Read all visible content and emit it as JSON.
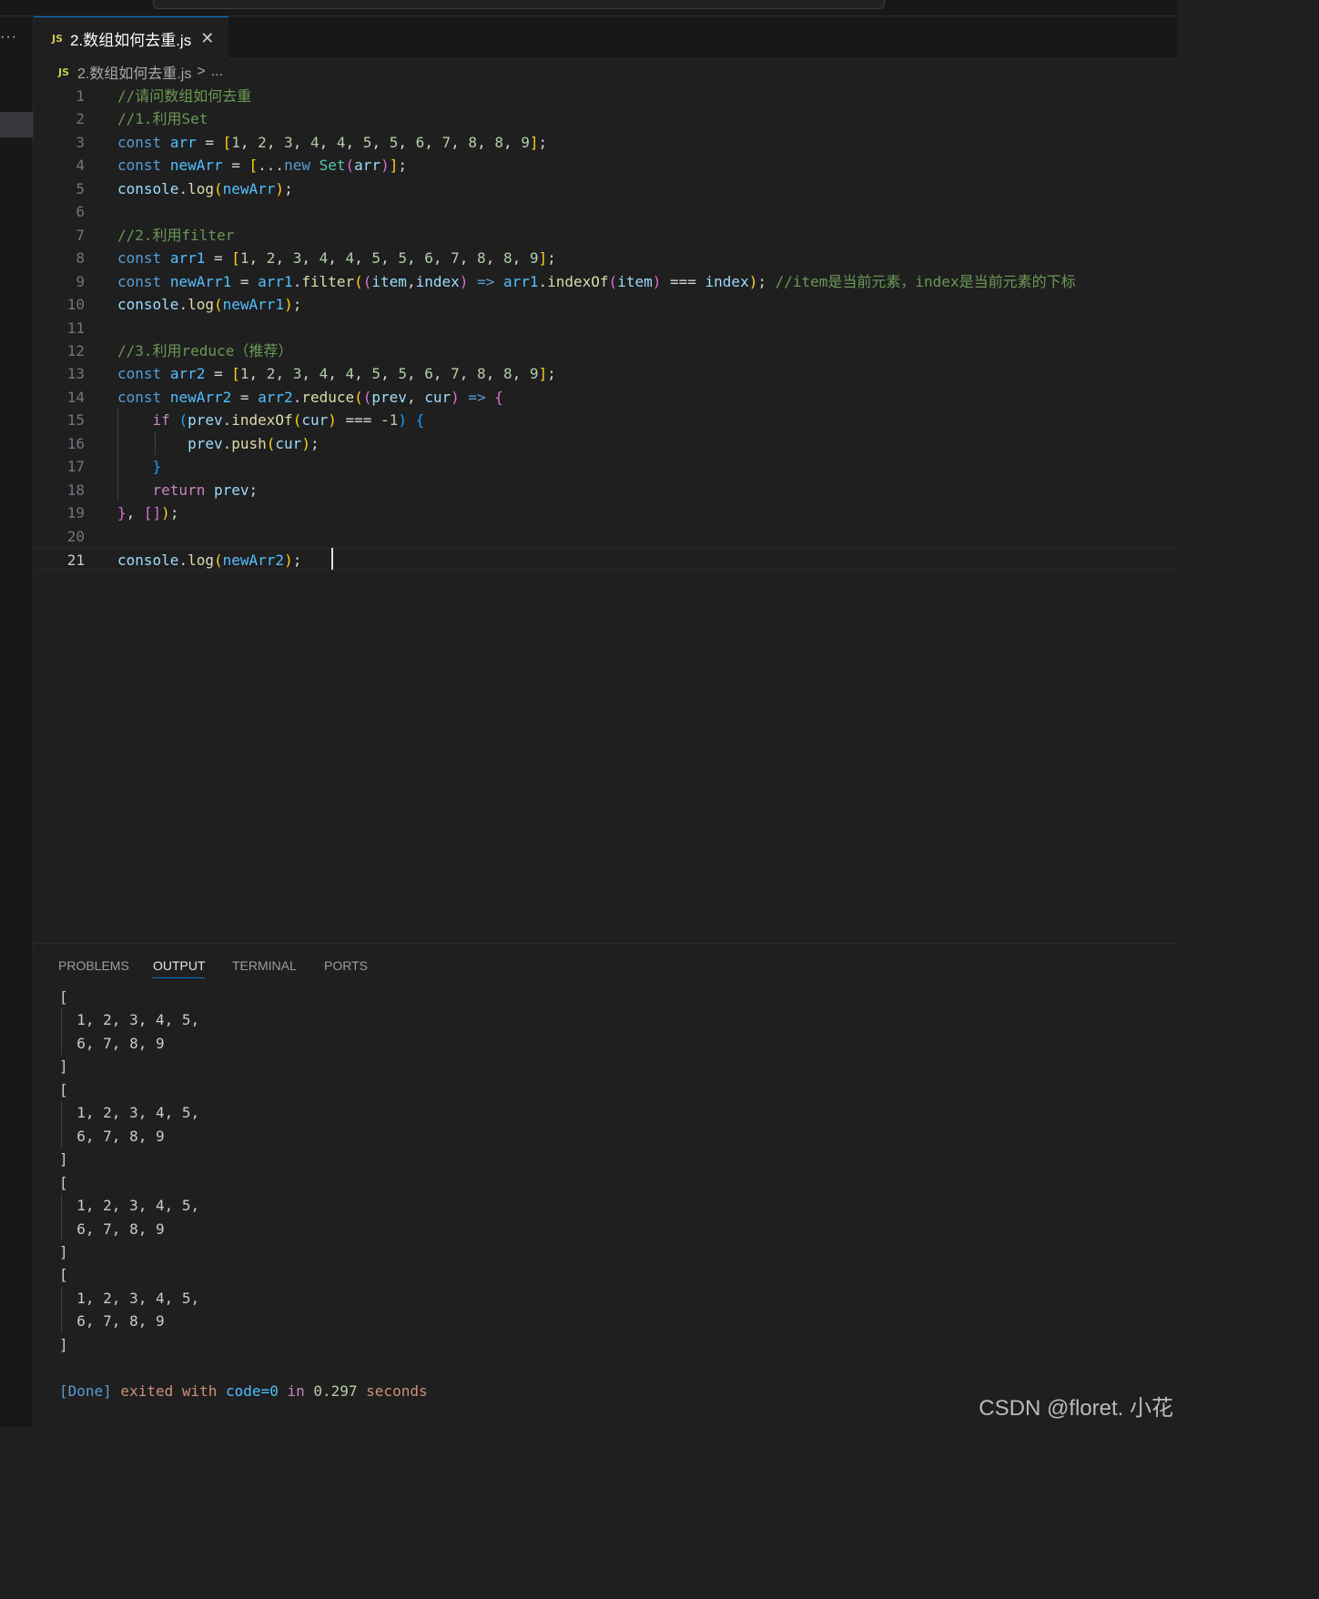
{
  "tab": {
    "badge": "JS",
    "title": "2.数组如何去重.js",
    "close": "✕"
  },
  "sidebar": {
    "overflow": "···"
  },
  "breadcrumb": {
    "badge": "JS",
    "file": "2.数组如何去重.js",
    "sep": ">",
    "rest": "..."
  },
  "editor": {
    "lines": [
      {
        "n": "1",
        "tokens": [
          [
            "c-com",
            "//请问数组如何去重"
          ]
        ]
      },
      {
        "n": "2",
        "tokens": [
          [
            "c-com",
            "//1.利用Set"
          ]
        ]
      },
      {
        "n": "3",
        "tokens": [
          [
            "c-kw",
            "const"
          ],
          [
            "c-op",
            " "
          ],
          [
            "c-cst",
            "arr"
          ],
          [
            "c-op",
            " = "
          ],
          [
            "b1",
            "["
          ],
          [
            "c-num",
            "1"
          ],
          [
            "c-op",
            ", "
          ],
          [
            "c-num",
            "2"
          ],
          [
            "c-op",
            ", "
          ],
          [
            "c-num",
            "3"
          ],
          [
            "c-op",
            ", "
          ],
          [
            "c-num",
            "4"
          ],
          [
            "c-op",
            ", "
          ],
          [
            "c-num",
            "4"
          ],
          [
            "c-op",
            ", "
          ],
          [
            "c-num",
            "5"
          ],
          [
            "c-op",
            ", "
          ],
          [
            "c-num",
            "5"
          ],
          [
            "c-op",
            ", "
          ],
          [
            "c-num",
            "6"
          ],
          [
            "c-op",
            ", "
          ],
          [
            "c-num",
            "7"
          ],
          [
            "c-op",
            ", "
          ],
          [
            "c-num",
            "8"
          ],
          [
            "c-op",
            ", "
          ],
          [
            "c-num",
            "8"
          ],
          [
            "c-op",
            ", "
          ],
          [
            "c-num",
            "9"
          ],
          [
            "b1",
            "]"
          ],
          [
            "c-op",
            ";"
          ]
        ]
      },
      {
        "n": "4",
        "tokens": [
          [
            "c-kw",
            "const"
          ],
          [
            "c-op",
            " "
          ],
          [
            "c-cst",
            "newArr"
          ],
          [
            "c-op",
            " = "
          ],
          [
            "b1",
            "["
          ],
          [
            "c-op",
            "..."
          ],
          [
            "c-kw",
            "new"
          ],
          [
            "c-op",
            " "
          ],
          [
            "c-cls",
            "Set"
          ],
          [
            "b2",
            "("
          ],
          [
            "c-var",
            "arr"
          ],
          [
            "b2",
            ")"
          ],
          [
            "b1",
            "]"
          ],
          [
            "c-op",
            ";"
          ]
        ]
      },
      {
        "n": "5",
        "tokens": [
          [
            "c-var",
            "console"
          ],
          [
            "c-op",
            "."
          ],
          [
            "c-fn",
            "log"
          ],
          [
            "b1",
            "("
          ],
          [
            "c-cst",
            "newArr"
          ],
          [
            "b1",
            ")"
          ],
          [
            "c-op",
            ";"
          ]
        ]
      },
      {
        "n": "6",
        "tokens": []
      },
      {
        "n": "7",
        "tokens": [
          [
            "c-com",
            "//2.利用filter"
          ]
        ]
      },
      {
        "n": "8",
        "tokens": [
          [
            "c-kw",
            "const"
          ],
          [
            "c-op",
            " "
          ],
          [
            "c-cst",
            "arr1"
          ],
          [
            "c-op",
            " = "
          ],
          [
            "b1",
            "["
          ],
          [
            "c-num",
            "1"
          ],
          [
            "c-op",
            ", "
          ],
          [
            "c-num",
            "2"
          ],
          [
            "c-op",
            ", "
          ],
          [
            "c-num",
            "3"
          ],
          [
            "c-op",
            ", "
          ],
          [
            "c-num",
            "4"
          ],
          [
            "c-op",
            ", "
          ],
          [
            "c-num",
            "4"
          ],
          [
            "c-op",
            ", "
          ],
          [
            "c-num",
            "5"
          ],
          [
            "c-op",
            ", "
          ],
          [
            "c-num",
            "5"
          ],
          [
            "c-op",
            ", "
          ],
          [
            "c-num",
            "6"
          ],
          [
            "c-op",
            ", "
          ],
          [
            "c-num",
            "7"
          ],
          [
            "c-op",
            ", "
          ],
          [
            "c-num",
            "8"
          ],
          [
            "c-op",
            ", "
          ],
          [
            "c-num",
            "8"
          ],
          [
            "c-op",
            ", "
          ],
          [
            "c-num",
            "9"
          ],
          [
            "b1",
            "]"
          ],
          [
            "c-op",
            ";"
          ]
        ]
      },
      {
        "n": "9",
        "tokens": [
          [
            "c-kw",
            "const"
          ],
          [
            "c-op",
            " "
          ],
          [
            "c-cst",
            "newArr1"
          ],
          [
            "c-op",
            " = "
          ],
          [
            "c-cst",
            "arr1"
          ],
          [
            "c-op",
            "."
          ],
          [
            "c-fn",
            "filter"
          ],
          [
            "b1",
            "("
          ],
          [
            "b2",
            "("
          ],
          [
            "c-var",
            "item"
          ],
          [
            "c-op",
            ","
          ],
          [
            "c-var",
            "index"
          ],
          [
            "b2",
            ")"
          ],
          [
            "c-op",
            " "
          ],
          [
            "c-kw",
            "=>"
          ],
          [
            "c-op",
            " "
          ],
          [
            "c-cst",
            "arr1"
          ],
          [
            "c-op",
            "."
          ],
          [
            "c-fn",
            "indexOf"
          ],
          [
            "b2",
            "("
          ],
          [
            "c-var",
            "item"
          ],
          [
            "b2",
            ")"
          ],
          [
            "c-op",
            " === "
          ],
          [
            "c-var",
            "index"
          ],
          [
            "b1",
            ")"
          ],
          [
            "c-op",
            "; "
          ],
          [
            "c-com",
            "//item是当前元素，index是当前元素的下标"
          ]
        ]
      },
      {
        "n": "10",
        "tokens": [
          [
            "c-var",
            "console"
          ],
          [
            "c-op",
            "."
          ],
          [
            "c-fn",
            "log"
          ],
          [
            "b1",
            "("
          ],
          [
            "c-cst",
            "newArr1"
          ],
          [
            "b1",
            ")"
          ],
          [
            "c-op",
            ";"
          ]
        ]
      },
      {
        "n": "11",
        "tokens": []
      },
      {
        "n": "12",
        "tokens": [
          [
            "c-com",
            "//3.利用reduce（推荐）"
          ]
        ]
      },
      {
        "n": "13",
        "tokens": [
          [
            "c-kw",
            "const"
          ],
          [
            "c-op",
            " "
          ],
          [
            "c-cst",
            "arr2"
          ],
          [
            "c-op",
            " = "
          ],
          [
            "b1",
            "["
          ],
          [
            "c-num",
            "1"
          ],
          [
            "c-op",
            ", "
          ],
          [
            "c-num",
            "2"
          ],
          [
            "c-op",
            ", "
          ],
          [
            "c-num",
            "3"
          ],
          [
            "c-op",
            ", "
          ],
          [
            "c-num",
            "4"
          ],
          [
            "c-op",
            ", "
          ],
          [
            "c-num",
            "4"
          ],
          [
            "c-op",
            ", "
          ],
          [
            "c-num",
            "5"
          ],
          [
            "c-op",
            ", "
          ],
          [
            "c-num",
            "5"
          ],
          [
            "c-op",
            ", "
          ],
          [
            "c-num",
            "6"
          ],
          [
            "c-op",
            ", "
          ],
          [
            "c-num",
            "7"
          ],
          [
            "c-op",
            ", "
          ],
          [
            "c-num",
            "8"
          ],
          [
            "c-op",
            ", "
          ],
          [
            "c-num",
            "8"
          ],
          [
            "c-op",
            ", "
          ],
          [
            "c-num",
            "9"
          ],
          [
            "b1",
            "]"
          ],
          [
            "c-op",
            ";"
          ]
        ]
      },
      {
        "n": "14",
        "tokens": [
          [
            "c-kw",
            "const"
          ],
          [
            "c-op",
            " "
          ],
          [
            "c-cst",
            "newArr2"
          ],
          [
            "c-op",
            " = "
          ],
          [
            "c-cst",
            "arr2"
          ],
          [
            "c-op",
            "."
          ],
          [
            "c-fn",
            "reduce"
          ],
          [
            "b1",
            "("
          ],
          [
            "b2",
            "("
          ],
          [
            "c-var",
            "prev"
          ],
          [
            "c-op",
            ", "
          ],
          [
            "c-var",
            "cur"
          ],
          [
            "b2",
            ")"
          ],
          [
            "c-op",
            " "
          ],
          [
            "c-kw",
            "=>"
          ],
          [
            "c-op",
            " "
          ],
          [
            "b2",
            "{"
          ]
        ]
      },
      {
        "n": "15",
        "tokens": [
          [
            "c-op",
            "    "
          ],
          [
            "c-kw2",
            "if"
          ],
          [
            "c-op",
            " "
          ],
          [
            "b3",
            "("
          ],
          [
            "c-var",
            "prev"
          ],
          [
            "c-op",
            "."
          ],
          [
            "c-fn",
            "indexOf"
          ],
          [
            "b1",
            "("
          ],
          [
            "c-var",
            "cur"
          ],
          [
            "b1",
            ")"
          ],
          [
            "c-op",
            " === -"
          ],
          [
            "c-num",
            "1"
          ],
          [
            "b3",
            ")"
          ],
          [
            "c-op",
            " "
          ],
          [
            "b3",
            "{"
          ]
        ]
      },
      {
        "n": "16",
        "tokens": [
          [
            "c-op",
            "        "
          ],
          [
            "c-var",
            "prev"
          ],
          [
            "c-op",
            "."
          ],
          [
            "c-fn",
            "push"
          ],
          [
            "b1",
            "("
          ],
          [
            "c-var",
            "cur"
          ],
          [
            "b1",
            ")"
          ],
          [
            "c-op",
            ";"
          ]
        ]
      },
      {
        "n": "17",
        "tokens": [
          [
            "c-op",
            "    "
          ],
          [
            "b3",
            "}"
          ]
        ]
      },
      {
        "n": "18",
        "tokens": [
          [
            "c-op",
            "    "
          ],
          [
            "c-kw2",
            "return"
          ],
          [
            "c-op",
            " "
          ],
          [
            "c-var",
            "prev"
          ],
          [
            "c-op",
            ";"
          ]
        ]
      },
      {
        "n": "19",
        "tokens": [
          [
            "b2",
            "}"
          ],
          [
            "c-op",
            ", "
          ],
          [
            "b2",
            "[]"
          ],
          [
            "b1",
            ")"
          ],
          [
            "c-op",
            ";"
          ]
        ]
      },
      {
        "n": "20",
        "tokens": []
      },
      {
        "n": "21",
        "tokens": [
          [
            "c-var",
            "console"
          ],
          [
            "c-op",
            "."
          ],
          [
            "c-fn",
            "log"
          ],
          [
            "b1",
            "("
          ],
          [
            "c-cst",
            "newArr2"
          ],
          [
            "b1",
            ")"
          ],
          [
            "c-op",
            ";"
          ]
        ]
      }
    ]
  },
  "panel": {
    "tabs": [
      "PROBLEMS",
      "OUTPUT",
      "TERMINAL",
      "PORTS"
    ],
    "active_tab": "OUTPUT",
    "output_lines": [
      "[",
      "  1, 2, 3, 4, 5,",
      "  6, 7, 8, 9",
      "]",
      "[",
      "  1, 2, 3, 4, 5,",
      "  6, 7, 8, 9",
      "]",
      "[",
      "  1, 2, 3, 4, 5,",
      "  6, 7, 8, 9",
      "]",
      "[",
      "  1, 2, 3, 4, 5,",
      "  6, 7, 8, 9",
      "]"
    ],
    "done": {
      "tag": "[Done]",
      "text1": " exited with ",
      "code": "code=0",
      "in": " in ",
      "num": "0.297",
      "text2": " seconds"
    }
  },
  "watermark": "CSDN @floret. 小花"
}
